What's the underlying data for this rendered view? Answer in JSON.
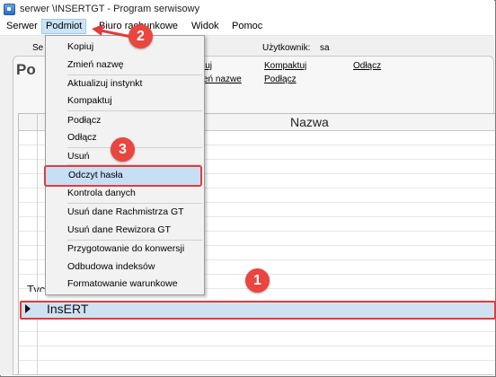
{
  "window": {
    "title": "serwer           \\INSERTGT - Program serwisowy"
  },
  "menubar": {
    "items": [
      "Serwer",
      "Podmiot",
      "Biuro rachunkowe",
      "Widok",
      "Pomoc"
    ]
  },
  "background": {
    "strip_left": "Se",
    "user_label": "Użytkownik:",
    "user_value": "sa",
    "links_row1": [
      "iuj",
      "Kompaktuj",
      "Odłącz"
    ],
    "links_row2": [
      "eń nazwe",
      "Podłącz"
    ],
    "panel_title": "Po",
    "grid": {
      "column_header": "Nazwa",
      "partial_row": "Tyczak",
      "selected_row": "InsERT"
    }
  },
  "dropdown": {
    "items": [
      "Kopiuj",
      "Zmień nazwę",
      "Aktualizuj instynkt",
      "Kompaktuj",
      "Podłącz",
      "Odłącz",
      "Usuń",
      "Odczyt hasła",
      "Kontrola danych",
      "Usuń dane Rachmistrza GT",
      "Usuń dane Rewizora GT",
      "Przygotowanie do konwersji",
      "Odbudowa indeksów",
      "Formatowanie warunkowe"
    ],
    "highlighted": "Odczyt hasła"
  },
  "callouts": [
    "1",
    "2",
    "3"
  ],
  "colors": {
    "highlight_border": "#e23b3b",
    "selection_fill": "#cfe2f3",
    "badge": "#e8463e"
  }
}
